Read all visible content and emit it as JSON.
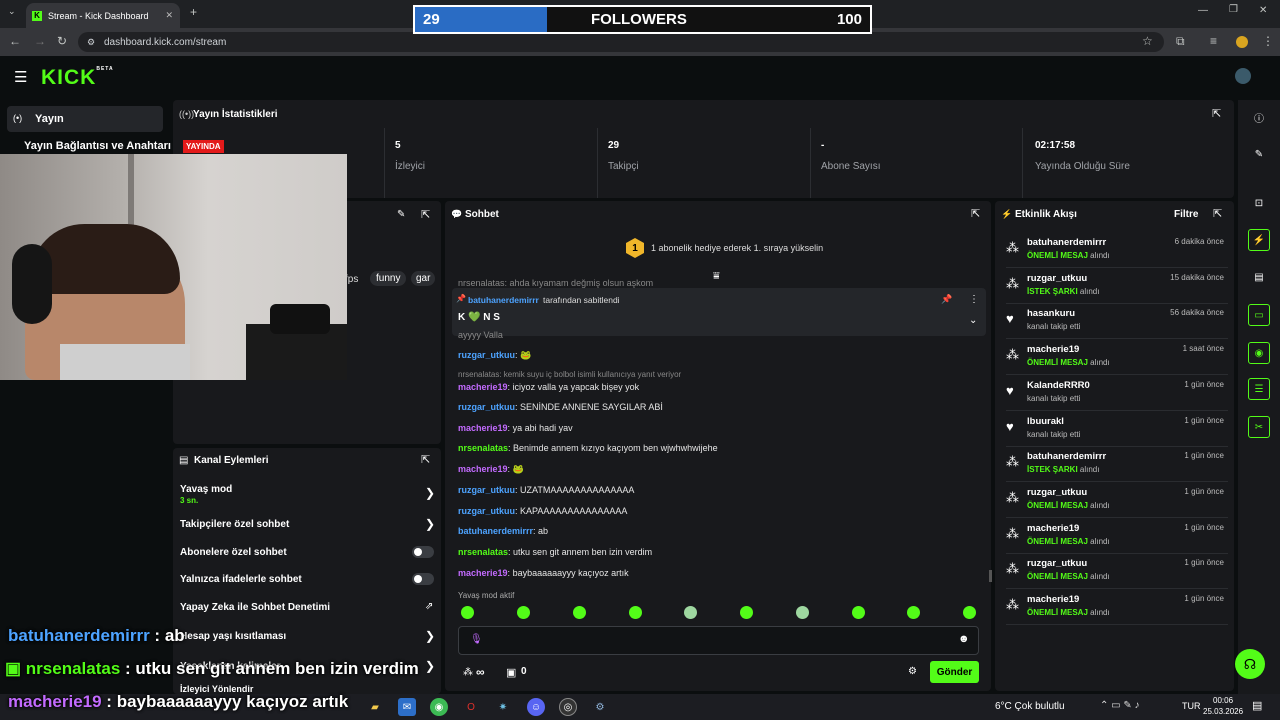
{
  "browser": {
    "tab_title": "Stream - Kick Dashboard",
    "tab_favicon": "K",
    "url": "dashboard.kick.com/stream"
  },
  "overlay_goal": {
    "current": "29",
    "label": "FOLLOWERS",
    "target": "100",
    "progress": 0.29
  },
  "brand": {
    "logo": "KICK",
    "badge": "BETA",
    "accent": "#53fc18"
  },
  "left_nav": {
    "active_item": "Yayın",
    "item2": "Yayın Bağlantısı ve Anahtarı"
  },
  "stats": {
    "title": "Yayın İstatistikleri",
    "live_badge": "YAYINDA",
    "items": [
      {
        "value": "5",
        "label": "İzleyici"
      },
      {
        "value": "29",
        "label": "Takipçi"
      },
      {
        "value": "-",
        "label": "Abone Sayısı"
      },
      {
        "value": "02:17:58",
        "label": "Yayında Olduğu Süre"
      }
    ]
  },
  "stream_info": {
    "tags": [
      "fps",
      "funny",
      "gar"
    ]
  },
  "channel_actions": {
    "title": "Kanal Eylemleri",
    "items": [
      {
        "label": "Yavaş mod",
        "sub": "3 sn."
      },
      {
        "label": "Takipçilere özel sohbet"
      },
      {
        "label": "Abonelere özel sohbet"
      },
      {
        "label": "Yalnızca ifadelerle sohbet"
      },
      {
        "label": "Yapay Zeka ile Sohbet Denetimi"
      },
      {
        "label": "Hesap yaşı kısıtlaması"
      },
      {
        "label": "Yasaklanan kelimeler"
      },
      {
        "label": "İzleyici Yönlendir"
      }
    ]
  },
  "chat": {
    "title": "Sohbet",
    "gift_banner": "1 abonelik hediye ederek 1. sıraya yükselin",
    "gift_rank": "1",
    "partial_top": "nrsenalatas: ahda kıyamam değmiş olsun aşkom",
    "pinned_by": "batuhanerdemirrr",
    "pinned_suffix": "tarafından sabitlendi",
    "pinned_message": "K 💚 N S",
    "partial_line": "ayyyy Valla",
    "messages": [
      {
        "user": "ruzgar_utkuu",
        "text": "🐸",
        "color": "#4da3ff"
      },
      {
        "reply": "nrsenalatas: kemik suyu iç bolbol isimli kullanıcıya yanıt veriyor"
      },
      {
        "user": "macherie19",
        "text": "iciyoz valla ya yapcak bişey yok",
        "color": "#c36bff"
      },
      {
        "user": "ruzgar_utkuu",
        "text": "SENİNDE ANNENE SAYGILAR ABİ",
        "color": "#4da3ff"
      },
      {
        "user": "macherie19",
        "text": "ya abi hadi yav",
        "color": "#c36bff"
      },
      {
        "user": "nrsenalatas",
        "text": "Benimde annem kızıyo kaçıyom ben wjwhwhwijehe",
        "color": "#53fc18"
      },
      {
        "user": "macherie19",
        "text": "🐸",
        "color": "#c36bff"
      },
      {
        "user": "ruzgar_utkuu",
        "text": "UZATMAAAAAAAAAAAAAA",
        "color": "#4da3ff"
      },
      {
        "user": "ruzgar_utkuu",
        "text": "KAPAAAAAAAAAAAAAAA",
        "color": "#4da3ff"
      },
      {
        "user": "batuhanerdemirrr",
        "text": "ab",
        "color": "#4da3ff"
      },
      {
        "user": "nrsenalatas",
        "text": "utku sen git annem ben izin verdim",
        "color": "#53fc18"
      },
      {
        "user": "macherie19",
        "text": "baybaaaaaayyy kaçıyoz artık",
        "color": "#c36bff"
      }
    ],
    "slow_mode": "Yavaş mod aktif",
    "send_button": "Gönder",
    "points": "∞",
    "gift_count": "0"
  },
  "events": {
    "title": "Etkinlik Akışı",
    "filter": "Filtre",
    "items": [
      {
        "name": "batuhanerdemirrr",
        "type": "ÖNEMLİ MESAJ",
        "suffix": "alındı",
        "time": "6 dakika önce"
      },
      {
        "name": "ruzgar_utkuu",
        "type": "İSTEK ŞARKI",
        "suffix": "alındı",
        "time": "15 dakika önce"
      },
      {
        "name": "hasankuru",
        "type": "",
        "suffix": "kanalı takip etti",
        "time": "56 dakika önce"
      },
      {
        "name": "macherie19",
        "type": "ÖNEMLİ MESAJ",
        "suffix": "alındı",
        "time": "1 saat önce"
      },
      {
        "name": "KalandeRRR0",
        "type": "",
        "suffix": "kanalı takip etti",
        "time": "1 gün önce"
      },
      {
        "name": "lbuurakl",
        "type": "",
        "suffix": "kanalı takip etti",
        "time": "1 gün önce"
      },
      {
        "name": "batuhanerdemirrr",
        "type": "İSTEK ŞARKI",
        "suffix": "alındı",
        "time": "1 gün önce"
      },
      {
        "name": "ruzgar_utkuu",
        "type": "ÖNEMLİ MESAJ",
        "suffix": "alındı",
        "time": "1 gün önce"
      },
      {
        "name": "macherie19",
        "type": "ÖNEMLİ MESAJ",
        "suffix": "alındı",
        "time": "1 gün önce"
      },
      {
        "name": "ruzgar_utkuu",
        "type": "ÖNEMLİ MESAJ",
        "suffix": "alındı",
        "time": "1 gün önce"
      },
      {
        "name": "macherie19",
        "type": "ÖNEMLİ MESAJ",
        "suffix": "alındı",
        "time": "1 gün önce"
      }
    ]
  },
  "stream_overlay_chat": [
    {
      "user": "batuhanerdemirrr",
      "text": "ab",
      "color": "#4da3ff"
    },
    {
      "user": "nrsenalatas",
      "text": "utku sen git annem ben izin verdim",
      "color": "#53fc18"
    },
    {
      "user": "macherie19",
      "text": "baybaaaaaayyy kaçıyoz artık",
      "color": "#c36bff"
    }
  ],
  "taskbar": {
    "weather": "6°C  Çok bulutlu",
    "lang": "TUR",
    "time": "00:06",
    "date": "25.03.2026"
  }
}
